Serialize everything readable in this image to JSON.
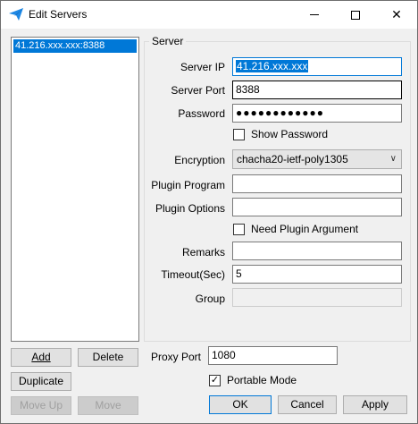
{
  "window": {
    "title": "Edit Servers"
  },
  "server_list": {
    "items": [
      "41.216.xxx.xxx:8388"
    ]
  },
  "server_group": {
    "title": "Server",
    "server_ip_label": "Server IP",
    "server_ip_value": "41.216.xxx.xxx",
    "server_port_label": "Server Port",
    "server_port_value": "8388",
    "password_label": "Password",
    "password_value": "●●●●●●●●●●●●",
    "show_password_label": "Show Password",
    "show_password_checked": false,
    "encryption_label": "Encryption",
    "encryption_value": "chacha20-ietf-poly1305",
    "plugin_program_label": "Plugin Program",
    "plugin_program_value": "",
    "plugin_options_label": "Plugin Options",
    "plugin_options_value": "",
    "need_plugin_argument_label": "Need Plugin Argument",
    "need_plugin_argument_checked": false,
    "remarks_label": "Remarks",
    "remarks_value": "",
    "timeout_label": "Timeout(Sec)",
    "timeout_value": "5",
    "group_label": "Group",
    "group_value": ""
  },
  "list_buttons": {
    "add": "Add",
    "delete": "Delete",
    "duplicate": "Duplicate",
    "move_up": "Move Up",
    "move": "Move"
  },
  "proxy": {
    "proxy_port_label": "Proxy Port",
    "proxy_port_value": "1080",
    "portable_mode_label": "Portable Mode",
    "portable_mode_checked": true
  },
  "dialog_buttons": {
    "ok": "OK",
    "cancel": "Cancel",
    "apply": "Apply"
  },
  "icons": {
    "app": "paper-plane-icon",
    "minimize": "minimize-icon",
    "maximize": "maximize-icon",
    "close": "close-icon",
    "dropdown": "chevron-down-icon",
    "check": "checkmark-icon"
  },
  "colors": {
    "accent": "#0078d7",
    "app_icon": "#1e88e5"
  }
}
